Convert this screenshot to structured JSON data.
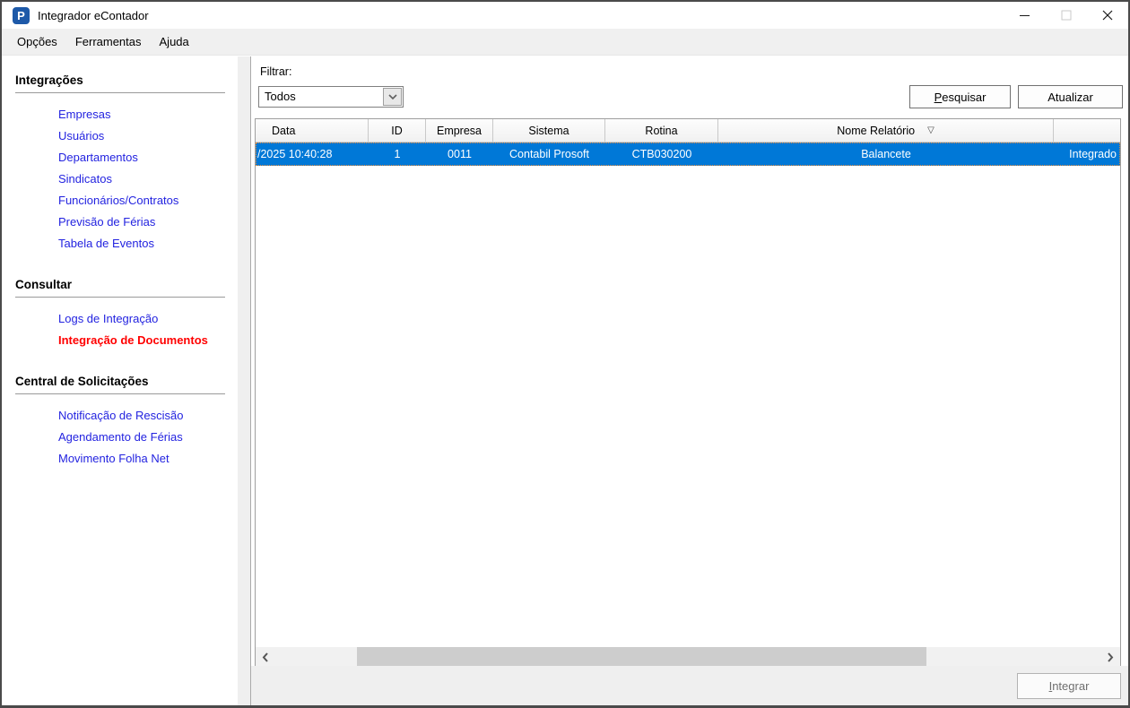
{
  "window": {
    "title": "Integrador eContador",
    "logo_letter": "P"
  },
  "menu": {
    "items": [
      {
        "label": "Opções",
        "name": "opcoes"
      },
      {
        "label": "Ferramentas",
        "name": "ferramentas"
      },
      {
        "label": "Ajuda",
        "name": "ajuda"
      }
    ]
  },
  "sidebar": {
    "sections": [
      {
        "title": "Integrações",
        "name": "integracoes",
        "items": [
          {
            "label": "Empresas",
            "name": "empresas"
          },
          {
            "label": "Usuários",
            "name": "usuarios"
          },
          {
            "label": "Departamentos",
            "name": "departamentos"
          },
          {
            "label": "Sindicatos",
            "name": "sindicatos"
          },
          {
            "label": "Funcionários/Contratos",
            "name": "funcionarios-contratos"
          },
          {
            "label": "Previsão de Férias",
            "name": "previsao-de-ferias"
          },
          {
            "label": "Tabela de Eventos",
            "name": "tabela-de-eventos"
          }
        ]
      },
      {
        "title": "Consultar",
        "name": "consultar",
        "items": [
          {
            "label": "Logs de Integração",
            "name": "logs-de-integracao"
          },
          {
            "label": "Integração de Documentos",
            "name": "integracao-de-documentos",
            "active": true
          }
        ]
      },
      {
        "title": "Central de Solicitações",
        "name": "central-de-solicitacoes",
        "items": [
          {
            "label": "Notificação de Rescisão",
            "name": "notificacao-de-rescisao"
          },
          {
            "label": "Agendamento de Férias",
            "name": "agendamento-de-ferias"
          },
          {
            "label": "Movimento Folha Net",
            "name": "movimento-folha-net"
          }
        ]
      }
    ]
  },
  "main": {
    "filter": {
      "label": "Filtrar:",
      "value": "Todos"
    },
    "buttons": {
      "search": "Pesquisar",
      "refresh": "Atualizar",
      "integrate": "Integrar"
    },
    "table": {
      "columns": [
        {
          "label": "Data",
          "name": "data"
        },
        {
          "label": "ID",
          "name": "id"
        },
        {
          "label": "Empresa",
          "name": "empresa"
        },
        {
          "label": "Sistema",
          "name": "sistema"
        },
        {
          "label": "Rotina",
          "name": "rotina"
        },
        {
          "label": "Nome Relatório",
          "name": "nome-relatorio",
          "sorted": true
        },
        {
          "label": "",
          "name": "status"
        }
      ],
      "rows": [
        [
          "/2025 10:40:28",
          "1",
          "0011",
          "Contabil Prosoft",
          "CTB030200",
          "Balancete",
          "Integrado"
        ]
      ]
    }
  },
  "icons": {
    "sort_indicator": "▽",
    "app_logo": "blue rounded square with white P"
  },
  "colors": {
    "selection_blue": "#0078d7",
    "link_blue": "#2323e0",
    "active_link_red": "#ff0000",
    "logo_blue": "#1d59a8",
    "focus_dotted_orange": "#e08a3c",
    "menubar_gray": "#f0f0f0"
  }
}
